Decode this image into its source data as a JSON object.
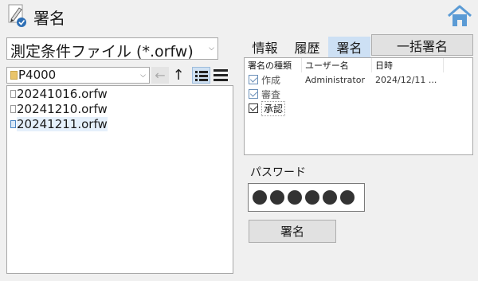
{
  "app": {
    "title": "署名"
  },
  "file_type": {
    "selected": "測定条件ファイル (*.orfw)"
  },
  "folder": {
    "selected": "P4000"
  },
  "files": [
    {
      "name": "20241016.orfw",
      "selected": false
    },
    {
      "name": "20241210.orfw",
      "selected": false
    },
    {
      "name": "20241211.orfw",
      "selected": true
    }
  ],
  "tabs": [
    {
      "label": "情報",
      "active": false
    },
    {
      "label": "履歴",
      "active": false
    },
    {
      "label": "署名",
      "active": true
    }
  ],
  "bulk_sign_label": "一括署名",
  "signatures": {
    "headers": [
      "署名の種類",
      "ユーザー名",
      "日時"
    ],
    "rows": [
      {
        "type": "作成",
        "checked": true,
        "user": "Administrator",
        "date": "2024/12/11 ..."
      },
      {
        "type": "審査",
        "checked": true,
        "user": "",
        "date": ""
      },
      {
        "type": "承認",
        "checked": true,
        "user": "",
        "date": ""
      }
    ]
  },
  "password": {
    "label": "パスワード",
    "masked_length": 6
  },
  "sign_button_label": "署名",
  "colors": {
    "tab_active": "#cde0f4",
    "selection": "#e5f0fb",
    "home_icon": "#5b9bd5"
  }
}
